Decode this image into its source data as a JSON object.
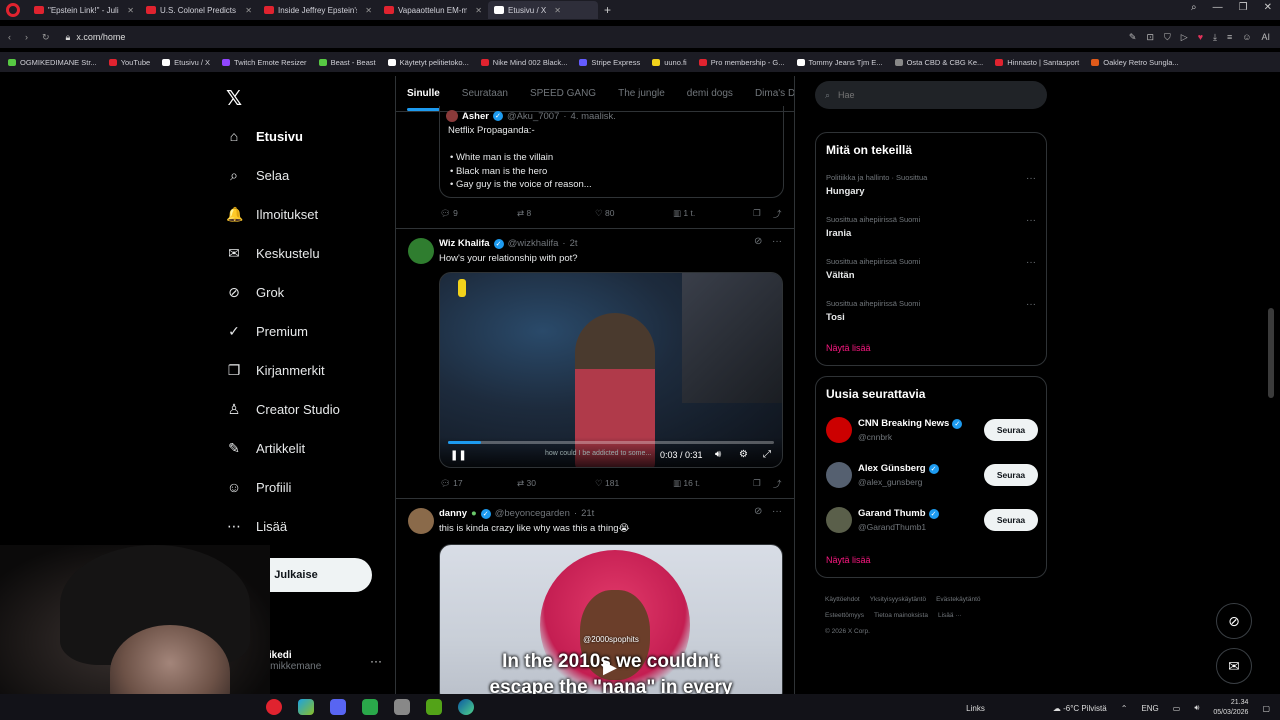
{
  "browser": {
    "tabs": [
      {
        "label": "\"Epstein Link!\" - Julian UN",
        "color": "#e0232f"
      },
      {
        "label": "U.S. Colonel Predicts Iran",
        "color": "#e0232f"
      },
      {
        "label": "Inside Jeffrey Epstein's \"Gi",
        "color": "#e0232f"
      },
      {
        "label": "Vapaaottelun EM-mestari",
        "color": "#e0232f"
      },
      {
        "label": "Etusivu / X",
        "color": "#ffffff"
      }
    ],
    "active_tab_index": 4,
    "url": "x.com/home",
    "bookmarks": [
      {
        "label": "OGMIKEDIMANE Str...",
        "color": "#57c943"
      },
      {
        "label": "YouTube",
        "color": "#e0232f"
      },
      {
        "label": "Etusivu / X",
        "color": "#ffffff"
      },
      {
        "label": "Twitch Emote Resizer",
        "color": "#9146ff"
      },
      {
        "label": "Beast - Beast",
        "color": "#57c943"
      },
      {
        "label": "Käytetyt pelitietoko...",
        "color": "#ffffff"
      },
      {
        "label": "Nike Mind 002 Black...",
        "color": "#e0232f"
      },
      {
        "label": "Stripe Express",
        "color": "#635bff"
      },
      {
        "label": "uuno.fi",
        "color": "#f2d21b"
      },
      {
        "label": "Pro membership - G...",
        "color": "#e0232f"
      },
      {
        "label": "Tommy Jeans Tjm E...",
        "color": "#ffffff"
      },
      {
        "label": "Osta CBD & CBG Ke...",
        "color": "#888888"
      },
      {
        "label": "Hinnasto | Santasport",
        "color": "#e0232f"
      },
      {
        "label": "Oakley Retro Sungla...",
        "color": "#e05a1a"
      }
    ]
  },
  "leftnav": {
    "items": [
      {
        "label": "Etusivu",
        "icon": "home-icon",
        "glyph": "⌂"
      },
      {
        "label": "Selaa",
        "icon": "search-icon",
        "glyph": "⌕"
      },
      {
        "label": "Ilmoitukset",
        "icon": "bell-icon",
        "glyph": "🔔"
      },
      {
        "label": "Keskustelu",
        "icon": "mail-icon",
        "glyph": "✉"
      },
      {
        "label": "Grok",
        "icon": "grok-icon",
        "glyph": "⊘"
      },
      {
        "label": "Premium",
        "icon": "premium-icon",
        "glyph": "✓"
      },
      {
        "label": "Kirjanmerkit",
        "icon": "bookmark-icon",
        "glyph": "❐"
      },
      {
        "label": "Creator Studio",
        "icon": "creator-icon",
        "glyph": "♙"
      },
      {
        "label": "Artikkelit",
        "icon": "article-icon",
        "glyph": "✎"
      },
      {
        "label": "Profiili",
        "icon": "profile-icon",
        "glyph": "☺"
      },
      {
        "label": "Lisää",
        "icon": "more-icon",
        "glyph": "⋯"
      }
    ],
    "post_label": "Julkaise",
    "account": {
      "name": "mikedi",
      "handle": "@mikkemane"
    }
  },
  "feed": {
    "tabs": [
      "Sinulle",
      "Seurataan",
      "SPEED GANG",
      "The jungle",
      "demi dogs",
      "Dima's Dist"
    ],
    "quote": {
      "author": "Asher",
      "handle": "@Aku_7007",
      "time": "4. maalisk.",
      "lines": [
        "Netflix Propaganda:-",
        "",
        "• White man is the villain",
        "• Black man is the hero",
        "• Gay guy is the voice of reason..."
      ]
    },
    "tweet1_actions": {
      "replies": "9",
      "reposts": "8",
      "likes": "80",
      "views": "1 t."
    },
    "tweet2": {
      "name": "Wiz Khalifa",
      "handle": "@wizkhalifa",
      "time": "2t",
      "text": "How's your relationship with pot?",
      "video_time": "0:03 / 0:31",
      "video_progress": 0.1,
      "caption": "how could I be addicted to some...",
      "actions": {
        "replies": "17",
        "reposts": "30",
        "likes": "181",
        "views": "16 t."
      }
    },
    "tweet3": {
      "name": "danny",
      "handle": "@beyoncegarden",
      "time": "21t",
      "text": "this is kinda crazy like why was this a thing😭",
      "video_handle": "@2000spophits",
      "subtitle_lines": [
        "In the 2010s we couldn't",
        "escape the \"nana\" in every"
      ]
    }
  },
  "sidebar": {
    "search_placeholder": "Hae",
    "trends_title": "Mitä on tekeillä",
    "trends": [
      {
        "meta": "Politiikka ja hallinto · Suosittua",
        "title": "Hungary"
      },
      {
        "meta": "Suosittua aihepiirissä Suomi",
        "title": "Irania"
      },
      {
        "meta": "Suosittua aihepiirissä Suomi",
        "title": "Vältän"
      },
      {
        "meta": "Suosittua aihepiirissä Suomi",
        "title": "Tosi"
      }
    ],
    "show_more": "Näytä lisää",
    "who_title": "Uusia seurattavia",
    "who": [
      {
        "name": "CNN Breaking News",
        "handle": "@cnnbrk",
        "color": "#cc0000"
      },
      {
        "name": "Alex Günsberg",
        "handle": "@alex_gunsberg",
        "color": "#556070"
      },
      {
        "name": "Garand Thumb",
        "handle": "@GarandThumb1",
        "color": "#5a5f4a"
      }
    ],
    "follow_label": "Seuraa",
    "footer": [
      "Käyttöehdot",
      "Yksityisyyskäytäntö",
      "Evästekäytäntö",
      "Esteettömyys",
      "Tietoa mainoksista",
      "Lisää ···",
      "© 2026 X Corp."
    ]
  },
  "taskbar": {
    "links": "Links",
    "weather": "-6°C Pilvistä",
    "lang": "ENG",
    "time": "21.34",
    "date": "05/03/2026"
  }
}
